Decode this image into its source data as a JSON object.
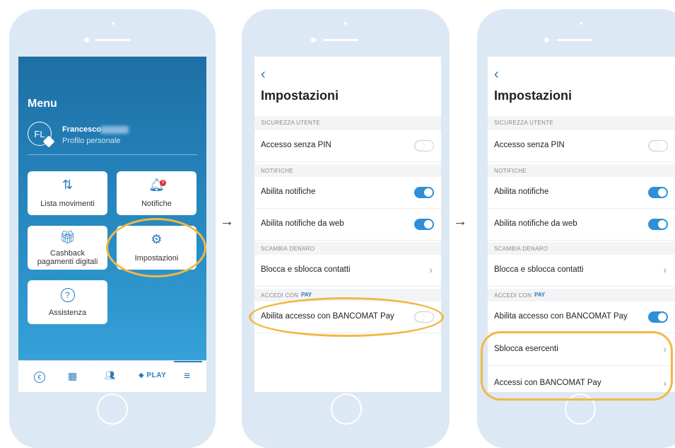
{
  "screen1": {
    "menu_title": "Menu",
    "avatar_initials": "FL",
    "user_name": "Francesco",
    "profile_label": "Profilo personale",
    "tiles": [
      {
        "label": "Lista movimenti",
        "icon": "transactions-icon"
      },
      {
        "label": "Notifiche",
        "icon": "bell-icon",
        "badge": "3"
      },
      {
        "label": "Cashback pagamenti digitali",
        "icon": "gift-icon"
      },
      {
        "label": "Impostazioni",
        "icon": "gear-icon"
      },
      {
        "label": "Assistenza",
        "icon": "help-icon"
      }
    ],
    "tabbar": {
      "play_label": "PLAY"
    }
  },
  "settings": {
    "title": "Impostazioni",
    "sections": {
      "security": "SICUREZZA UTENTE",
      "notifications": "NOTIFICHE",
      "exchange": "SCAMBIA DENARO",
      "access": "ACCEDI CON"
    },
    "rows": {
      "no_pin": "Accesso senza PIN",
      "enable_notifications": "Abilita notifiche",
      "enable_web_notifications": "Abilita notifiche da web",
      "block_contacts": "Blocca e sblocca contatti",
      "enable_bancomat": "Abilita accesso con BANCOMAT Pay",
      "unlock_merchants": "Sblocca esercenti",
      "bancomat_accesses": "Accessi con BANCOMAT Pay"
    },
    "pay_logo": "PAY"
  },
  "arrows": {
    "symbol": "→"
  },
  "colors": {
    "accent": "#2f8fd6",
    "highlight": "#f2b845",
    "phone": "#dce8f3"
  }
}
